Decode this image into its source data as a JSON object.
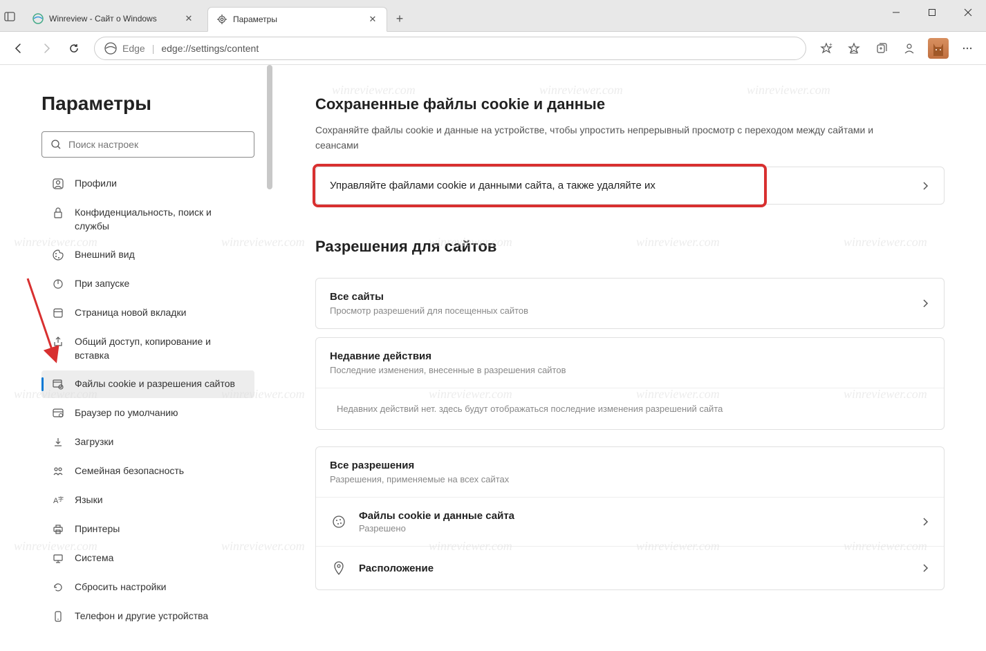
{
  "tabs": [
    {
      "label": "Winreview - Сайт о Windows",
      "active": false
    },
    {
      "label": "Параметры",
      "active": true
    }
  ],
  "url": {
    "prefix": "Edge",
    "path": "edge://settings/content"
  },
  "sidebar": {
    "title": "Параметры",
    "search_placeholder": "Поиск настроек",
    "items": [
      {
        "label": "Профили"
      },
      {
        "label": "Конфиденциальность, поиск и службы"
      },
      {
        "label": "Внешний вид"
      },
      {
        "label": "При запуске"
      },
      {
        "label": "Страница новой вкладки"
      },
      {
        "label": "Общий доступ, копирование и вставка"
      },
      {
        "label": "Файлы cookie и разрешения сайтов"
      },
      {
        "label": "Браузер по умолчанию"
      },
      {
        "label": "Загрузки"
      },
      {
        "label": "Семейная безопасность"
      },
      {
        "label": "Языки"
      },
      {
        "label": "Принтеры"
      },
      {
        "label": "Система"
      },
      {
        "label": "Сбросить настройки"
      },
      {
        "label": "Телефон и другие устройства"
      }
    ]
  },
  "main": {
    "h1": "Сохраненные файлы cookie и данные",
    "desc1": "Сохраняйте файлы cookie и данные на устройстве, чтобы упростить непрерывный просмотр с переходом между сайтами и сеансами",
    "manage_card": "Управляйте файлами cookie и данными сайта, а также удаляйте их",
    "h2": "Разрешения для сайтов",
    "all_sites": {
      "title": "Все сайты",
      "sub": "Просмотр разрешений для посещенных сайтов"
    },
    "recent": {
      "title": "Недавние действия",
      "sub": "Последние изменения, внесенные в разрешения сайтов",
      "body": "Недавних действий нет. здесь будут отображаться последние изменения разрешений сайта"
    },
    "all_perms": {
      "title": "Все разрешения",
      "sub": "Разрешения, применяемые на всех сайтах"
    },
    "perm1": {
      "title": "Файлы cookie и данные сайта",
      "sub": "Разрешено"
    },
    "perm2": {
      "title": "Расположение"
    }
  },
  "watermark": "winreviewer.com"
}
